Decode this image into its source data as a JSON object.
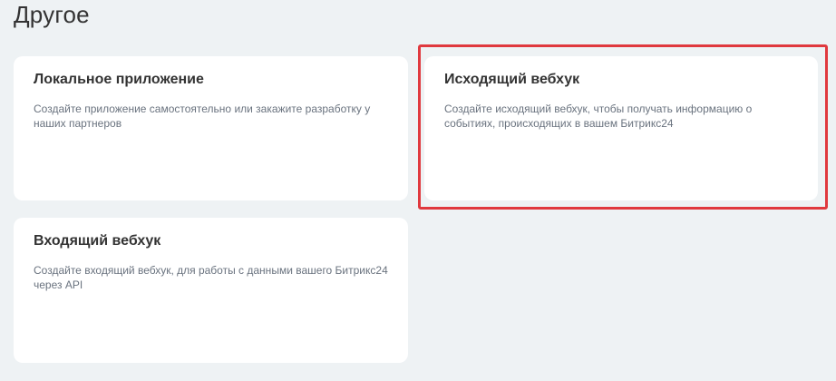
{
  "page": {
    "title": "Другое"
  },
  "cards": [
    {
      "title": "Локальное приложение",
      "description": "Создайте приложение самостоятельно или закажите разработку у наших партнеров"
    },
    {
      "title": "Исходящий вебхук",
      "description": "Создайте исходящий вебхук, чтобы получать информацию о событиях, происходящих в вашем Битрикс24"
    },
    {
      "title": "Входящий вебхук",
      "description": "Создайте входящий вебхук, для работы с данными вашего Битрикс24 через API"
    }
  ],
  "colors": {
    "background": "#eef2f4",
    "card": "#ffffff",
    "highlight": "#e0393e",
    "title": "#333333",
    "description": "#6a737f"
  }
}
